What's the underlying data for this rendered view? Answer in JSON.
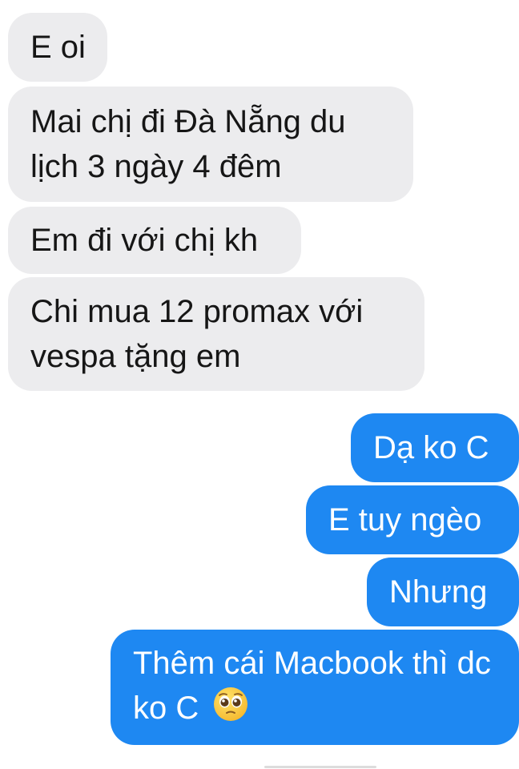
{
  "messages": {
    "incoming": [
      {
        "text": "E oi"
      },
      {
        "text": "Mai chị đi Đà Nẵng du lịch 3 ngày 4 đêm"
      },
      {
        "text": "Em đi với chị kh"
      },
      {
        "text": "Chi mua 12 promax với vespa tặng em"
      }
    ],
    "outgoing": [
      {
        "text": "Dạ ko C"
      },
      {
        "text": "E tuy ngèo"
      },
      {
        "text": "Nhưng"
      },
      {
        "text": "Thêm cái Macbook thì dc ko C",
        "emoji": "pleading-face-emoji"
      }
    ]
  },
  "colors": {
    "incoming_bg": "#ececee",
    "outgoing_bg": "#1e88f2"
  }
}
